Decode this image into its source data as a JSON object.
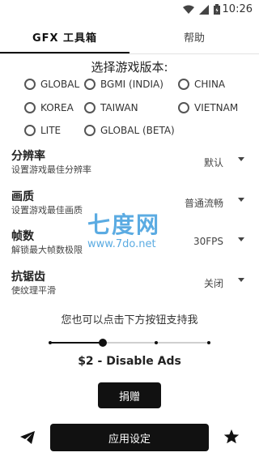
{
  "status_bar": {
    "time": "10:26"
  },
  "tabs": [
    {
      "label": "GFX 工具箱",
      "active": true
    },
    {
      "label": "帮助",
      "active": false
    }
  ],
  "version_section": {
    "title": "选择游戏版本:",
    "options": [
      {
        "label": "GLOBAL",
        "selected": false
      },
      {
        "label": "BGMI (INDIA)",
        "selected": false
      },
      {
        "label": "CHINA",
        "selected": false
      },
      {
        "label": "KOREA",
        "selected": false
      },
      {
        "label": "TAIWAN",
        "selected": false
      },
      {
        "label": "VIETNAM",
        "selected": false
      },
      {
        "label": "LITE",
        "selected": false
      },
      {
        "label": "GLOBAL (BETA)",
        "selected": false
      }
    ]
  },
  "settings": [
    {
      "title": "分辨率",
      "desc": "设置游戏最佳分辨率",
      "value": "默认"
    },
    {
      "title": "画质",
      "desc": "设置游戏最佳画质",
      "value": "普通流畅"
    },
    {
      "title": "帧数",
      "desc": "解锁最大帧数极限",
      "value": "30FPS"
    },
    {
      "title": "抗锯齿",
      "desc": "使纹理平滑",
      "value": "关闭"
    }
  ],
  "watermark": {
    "logo": "七度网",
    "url": "www.7do.net"
  },
  "support": {
    "text": "您也可以点击下方按钮支持我",
    "slider_position": 0.33,
    "slider_steps": 4,
    "price_label": "$2 - Disable Ads",
    "donate_label": "捐赠"
  },
  "bottom": {
    "apply_label": "应用设定"
  },
  "icons": {
    "wifi": "wifi-icon",
    "signal": "cell-signal-icon",
    "battery": "battery-icon",
    "send": "telegram-send-icon",
    "star": "star-icon"
  },
  "colors": {
    "primary": "#111111",
    "watermark": "#4aa3df"
  }
}
